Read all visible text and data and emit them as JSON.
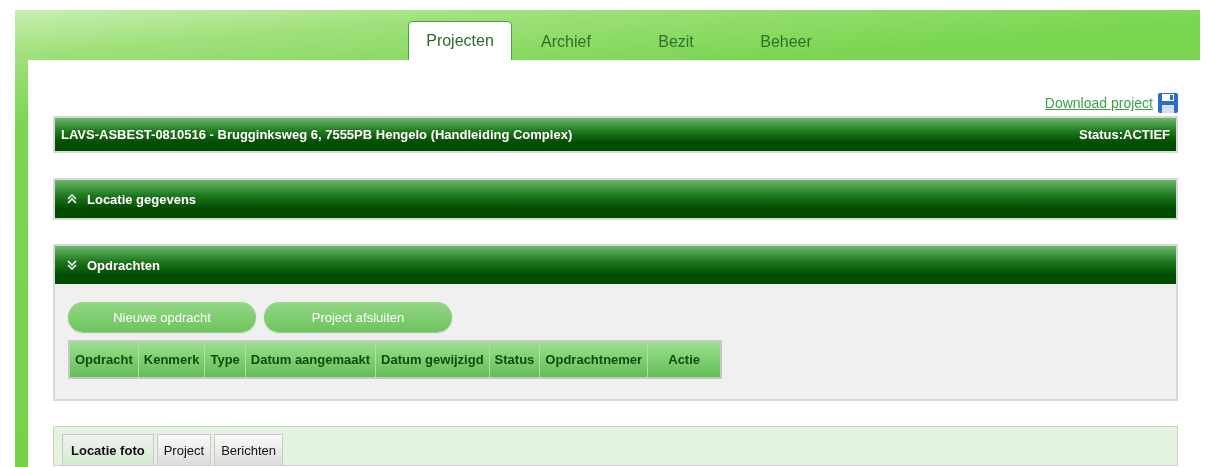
{
  "nav_tabs": [
    {
      "label": "Projecten",
      "selected": true
    },
    {
      "label": "Archief",
      "selected": false
    },
    {
      "label": "Bezit",
      "selected": false
    },
    {
      "label": "Beheer",
      "selected": false
    }
  ],
  "download_link": "Download project",
  "project_bar": {
    "title": "LAVS-ASBEST-0810516 - Brugginksweg 6, 7555PB Hengelo (Handleiding Complex)",
    "status": "Status:ACTIEF"
  },
  "sections": [
    {
      "title": "Locatie gegevens",
      "expanded": false
    },
    {
      "title": "Opdrachten",
      "expanded": true,
      "buttons": [
        "Nieuwe opdracht",
        "Project afsluiten"
      ],
      "table": {
        "columns": [
          "Opdracht",
          "Kenmerk",
          "Type",
          "Datum aangemaakt",
          "Datum gewijzigd",
          "Status",
          "Opdrachtnemer",
          "Actie"
        ]
      }
    }
  ],
  "bottom_tabs": [
    {
      "label": "Locatie foto",
      "selected": true
    },
    {
      "label": "Project",
      "selected": false
    },
    {
      "label": "Berichten",
      "selected": false
    }
  ]
}
